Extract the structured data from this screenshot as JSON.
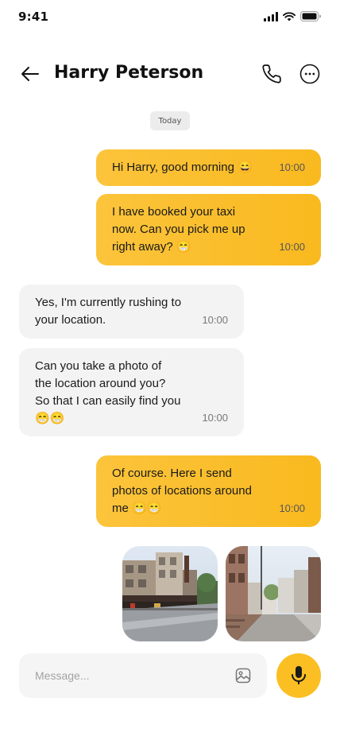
{
  "status_bar": {
    "time": "9:41"
  },
  "header": {
    "contact_name": "Harry Peterson"
  },
  "date_divider": "Today",
  "messages": [
    {
      "direction": "outgoing",
      "text": "Hi Harry, good morning 😄",
      "time": "10:00"
    },
    {
      "direction": "outgoing",
      "text": "I have booked your taxi\nnow. Can you pick me up\nright away? 😁",
      "time": "10:00"
    },
    {
      "direction": "incoming",
      "text": "Yes, I'm currently rushing to\nyour location.",
      "time": "10:00"
    },
    {
      "direction": "incoming",
      "text": "Can you take a photo of\nthe location around you?\nSo that I can easily find you\n😁😁",
      "time": "10:00"
    },
    {
      "direction": "outgoing",
      "text": "Of course. Here I send\nphotos of locations around\nme 😁😁",
      "time": "10:00"
    }
  ],
  "photos": [
    "street-corner-photo",
    "hillside-street-photo"
  ],
  "composer": {
    "placeholder": "Message..."
  },
  "colors": {
    "accent": "#FBBF24",
    "incoming_bubble": "#F3F3F3"
  }
}
